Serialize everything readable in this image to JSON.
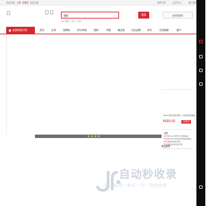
{
  "topbar": {
    "welcome": "欢迎光临",
    "city_label": "上海",
    "login": "请登录",
    "register": "免费注册",
    "right_links": [
      "我的订单",
      "会员中心",
      "客户服务"
    ]
  },
  "search": {
    "value": "搜索",
    "button_label": "搜索",
    "hot_words": [
      "热门搜索",
      "办公",
      "手机"
    ]
  },
  "cart": {
    "label": "我的购物车"
  },
  "nav": {
    "category_label": "全部商品分类",
    "items": [
      "首页",
      "正局",
      "品牌街",
      "积分商城",
      "团购",
      "专题",
      "最优惠",
      "社区品牌",
      "资讯",
      "在线客服",
      "圈子"
    ]
  },
  "sidebar": {
    "product_title": "MACA 电子商务清单：元旦月活动商品",
    "price": "¥699.00",
    "buy_label": "立即购买",
    "news_heading": "公告",
    "news": [
      {
        "tag": "[公告]",
        "text": "Sonay 年中大促 优惠来袭"
      },
      {
        "tag": "[公告]",
        "text": "Sonay 手机等系列新品发布会"
      },
      {
        "tag": "[公告]",
        "text": "品牌商城升级中"
      },
      {
        "tag": "[公告]",
        "text": "品牌店铺全面升级"
      }
    ],
    "section2_heading": "新品推荐"
  },
  "banner": {
    "active_slide": 1,
    "slides": 4
  },
  "watermark": {
    "main": "自动秒收录",
    "sub": "做上链接一来访一次一自动收录"
  },
  "colors": {
    "accent": "#d8282e",
    "topbar_bg": "#f4f4f4",
    "rail": "#0d0d0d"
  }
}
